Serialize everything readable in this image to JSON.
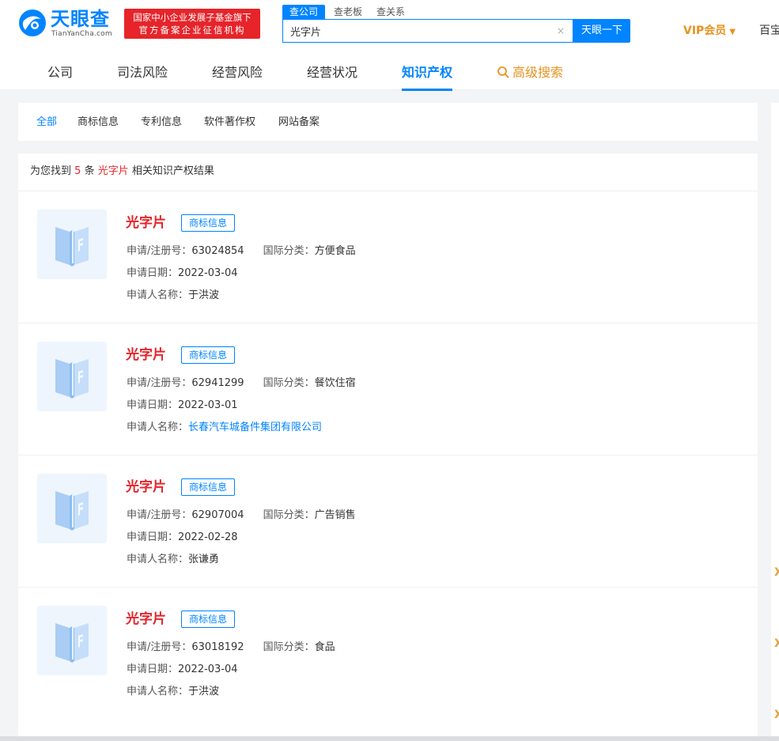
{
  "brand": {
    "name": "天眼查",
    "sub": "TianYanCha.com",
    "badge_line1": "国家中小企业发展子基金旗下",
    "badge_line2": "官方备案企业征信机构"
  },
  "search": {
    "tabs": [
      "查公司",
      "查老板",
      "查关系"
    ],
    "value": "光字片",
    "clear_glyph": "×",
    "button": "天眼一下"
  },
  "header_right": {
    "vip": "VIP会员",
    "vip_caret": "▼",
    "cut_off": "百宝"
  },
  "nav": {
    "items": [
      "公司",
      "司法风险",
      "经营风险",
      "经营状况",
      "知识产权",
      "高级搜索"
    ],
    "active": "知识产权"
  },
  "subtabs": {
    "items": [
      "全部",
      "商标信息",
      "专利信息",
      "软件著作权",
      "网站备案"
    ],
    "active": "全部"
  },
  "summary": {
    "prefix": "为您找到",
    "count": "5",
    "unit": "条",
    "keyword": "光字片",
    "suffix": "相关知识产权结果"
  },
  "labels": {
    "reg_no": "申请/注册号：",
    "intl_class": "国际分类：",
    "apply_date": "申请日期：",
    "applicant": "申请人名称："
  },
  "results": [
    {
      "title": "光字片",
      "tag": "商标信息",
      "reg_no": "63024854",
      "intl_class": "方便食品",
      "date": "2022-03-04",
      "applicant": "于洪波",
      "applicant_is_link": false
    },
    {
      "title": "光字片",
      "tag": "商标信息",
      "reg_no": "62941299",
      "intl_class": "餐饮住宿",
      "date": "2022-03-01",
      "applicant": "长春汽车城备件集团有限公司",
      "applicant_is_link": true
    },
    {
      "title": "光字片",
      "tag": "商标信息",
      "reg_no": "62907004",
      "intl_class": "广告销售",
      "date": "2022-02-28",
      "applicant": "张谦勇",
      "applicant_is_link": false
    },
    {
      "title": "光字片",
      "tag": "商标信息",
      "reg_no": "63018192",
      "intl_class": "食品",
      "date": "2022-03-04",
      "applicant": "于洪波",
      "applicant_is_link": false
    }
  ],
  "right_edge_glyphs": [
    "X",
    "X",
    "X"
  ],
  "colors": {
    "brand_blue": "#0084ff",
    "brand_red": "#e6242a",
    "vip_orange": "#e6921e"
  },
  "icons": {
    "logo": "tianyancha-logo-icon",
    "search": "search-icon",
    "trademark_placeholder": "trademark-book-icon"
  }
}
